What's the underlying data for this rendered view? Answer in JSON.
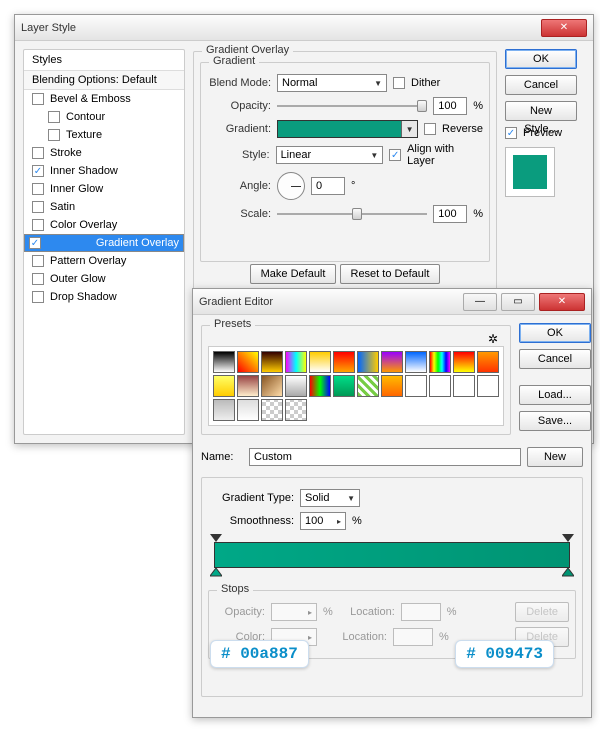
{
  "layerStyle": {
    "title": "Layer Style",
    "stylesHeader": "Styles",
    "blendingOptions": "Blending Options: Default",
    "styles": [
      {
        "label": "Bevel & Emboss",
        "checked": false,
        "selected": false,
        "indent": false
      },
      {
        "label": "Contour",
        "checked": false,
        "selected": false,
        "indent": true
      },
      {
        "label": "Texture",
        "checked": false,
        "selected": false,
        "indent": true
      },
      {
        "label": "Stroke",
        "checked": false,
        "selected": false,
        "indent": false
      },
      {
        "label": "Inner Shadow",
        "checked": true,
        "selected": false,
        "indent": false
      },
      {
        "label": "Inner Glow",
        "checked": false,
        "selected": false,
        "indent": false
      },
      {
        "label": "Satin",
        "checked": false,
        "selected": false,
        "indent": false
      },
      {
        "label": "Color Overlay",
        "checked": false,
        "selected": false,
        "indent": false
      },
      {
        "label": "Gradient Overlay",
        "checked": true,
        "selected": true,
        "indent": false
      },
      {
        "label": "Pattern Overlay",
        "checked": false,
        "selected": false,
        "indent": false
      },
      {
        "label": "Outer Glow",
        "checked": false,
        "selected": false,
        "indent": false
      },
      {
        "label": "Drop Shadow",
        "checked": false,
        "selected": false,
        "indent": false
      }
    ],
    "section": {
      "outerLabel": "Gradient Overlay",
      "innerLabel": "Gradient",
      "blendModeLabel": "Blend Mode:",
      "blendModeValue": "Normal",
      "ditherLabel": "Dither",
      "ditherChecked": false,
      "opacityLabel": "Opacity:",
      "opacityValue": "100",
      "pct": "%",
      "gradientLabel": "Gradient:",
      "reverseLabel": "Reverse",
      "reverseChecked": false,
      "styleLabel": "Style:",
      "styleValue": "Linear",
      "alignLabel": "Align with Layer",
      "alignChecked": true,
      "angleLabel": "Angle:",
      "angleValue": "0",
      "deg": "°",
      "scaleLabel": "Scale:",
      "scaleValue": "100",
      "makeDefault": "Make Default",
      "resetDefault": "Reset to Default"
    },
    "rightButtons": {
      "ok": "OK",
      "cancel": "Cancel",
      "newStyle": "New Style...",
      "previewLabel": "Preview",
      "previewChecked": true
    }
  },
  "gradientEditor": {
    "title": "Gradient Editor",
    "presetsLabel": "Presets",
    "presets": [
      "linear-gradient(#000,#fff)",
      "linear-gradient(45deg,red,yellow)",
      "linear-gradient(#300,#fc0)",
      "linear-gradient(90deg,#f0f,#0ff,#ff0)",
      "linear-gradient(#fc0,#fff)",
      "linear-gradient(red,orange)",
      "linear-gradient(90deg,#06f,#fc0)",
      "linear-gradient(#90f,#f90)",
      "linear-gradient(#06f,#fff)",
      "linear-gradient(90deg,red,yellow,lime,cyan,blue,magenta)",
      "linear-gradient(red,#ff0)",
      "linear-gradient(#f90,#f30)",
      "linear-gradient(#ff6,#fc0)",
      "linear-gradient(#944,#fec)",
      "linear-gradient(135deg,#852,#fda)",
      "linear-gradient(#fff,#aaa)",
      "linear-gradient(90deg,red,lime,blue)",
      "linear-gradient(#0d8,#095)",
      "repeating-linear-gradient(45deg,#7c4,#7c4 3px,#fff 3px,#fff 6px)",
      "linear-gradient(#fb0,#f60)",
      "linear-gradient(#fff,#fff)",
      "linear-gradient(#fff,#fff)",
      "linear-gradient(#fff,#fff)",
      "linear-gradient(#fff,#fff)",
      "linear-gradient(#bbb,#eee)",
      "linear-gradient(#ddd,#fff)"
    ],
    "nameLabel": "Name:",
    "nameValue": "Custom",
    "newBtn": "New",
    "gradientTypeLabel": "Gradient Type:",
    "gradientTypeValue": "Solid",
    "smoothnessLabel": "Smoothness:",
    "smoothnessValue": "100",
    "pct": "%",
    "stopsLabel": "Stops",
    "opacityLabel": "Opacity:",
    "locationLabel": "Location:",
    "colorLabel": "Color:",
    "deleteLabel": "Delete",
    "rightButtons": {
      "ok": "OK",
      "cancel": "Cancel",
      "load": "Load...",
      "save": "Save..."
    },
    "gradientColors": {
      "left": "#00a887",
      "right": "#009473"
    }
  },
  "callouts": {
    "left": "# 00a887",
    "right": "# 009473"
  }
}
